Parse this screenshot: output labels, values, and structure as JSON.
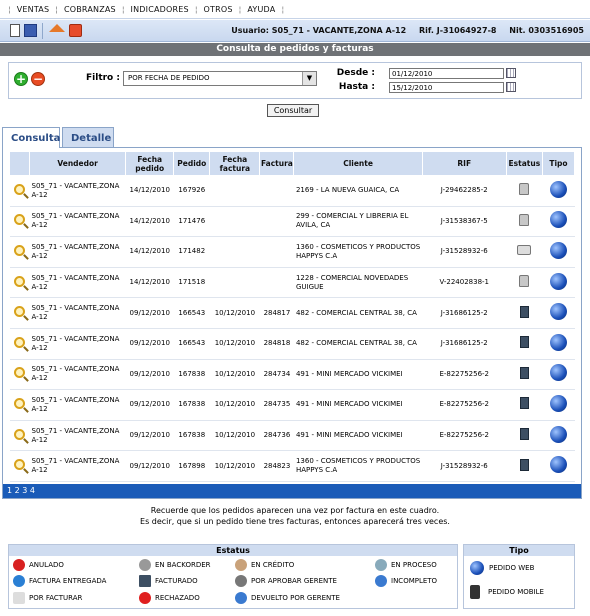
{
  "menu": [
    "VENTAS",
    "COBRANZAS",
    "INDICADORES",
    "OTROS",
    "AYUDA"
  ],
  "user": {
    "usuario": "Usuario: S05_71 - VACANTE,ZONA A-12",
    "rif": "Rif. J-31064927-8",
    "nit": "Nit. 0303516905"
  },
  "page_title": "Consulta de pedidos y facturas",
  "filter": {
    "label": "Filtro :",
    "value": "POR FECHA DE PEDIDO",
    "desde_label": "Desde :",
    "desde": "01/12/2010",
    "hasta_label": "Hasta :",
    "hasta": "15/12/2010",
    "button": "Consultar"
  },
  "tabs": [
    "Consulta",
    "Detalle"
  ],
  "table": {
    "headers": [
      "",
      "Vendedor",
      "Fecha pedido",
      "Pedido",
      "Fecha factura",
      "Factura",
      "Cliente",
      "RIF",
      "Estatus",
      "Tipo"
    ],
    "rows": [
      {
        "vendedor": "S05_71 - VACANTE,ZONA A-12",
        "fpedido": "14/12/2010",
        "pedido": "167926",
        "ffactura": "",
        "factura": "",
        "cliente": "2169 - LA NUEVA GUAICA, CA",
        "rif": "J-29462285-2",
        "estatus": "lock-icon"
      },
      {
        "vendedor": "S05_71 - VACANTE,ZONA A-12",
        "fpedido": "14/12/2010",
        "pedido": "171476",
        "ffactura": "",
        "factura": "",
        "cliente": "299 - COMERCIAL Y LIBRERIA EL AVILA, CA",
        "rif": "J-31538367-5",
        "estatus": "lock-icon"
      },
      {
        "vendedor": "S05_71 - VACANTE,ZONA A-12",
        "fpedido": "14/12/2010",
        "pedido": "171482",
        "ffactura": "",
        "factura": "",
        "cliente": "1360 - COSMETICOS Y PRODUCTOS HAPPYS C.A",
        "rif": "J-31528932-6",
        "estatus": "printer-icon"
      },
      {
        "vendedor": "S05_71 - VACANTE,ZONA A-12",
        "fpedido": "14/12/2010",
        "pedido": "171518",
        "ffactura": "",
        "factura": "",
        "cliente": "1228 - COMERCIAL NOVEDADES GUIGUE",
        "rif": "V-22402838-1",
        "estatus": "lock-icon"
      },
      {
        "vendedor": "S05_71 - VACANTE,ZONA A-12",
        "fpedido": "09/12/2010",
        "pedido": "166543",
        "ffactura": "10/12/2010",
        "factura": "284817",
        "cliente": "482 - COMERCIAL CENTRAL 38, CA",
        "rif": "J-31686125-2",
        "estatus": "book-icon"
      },
      {
        "vendedor": "S05_71 - VACANTE,ZONA A-12",
        "fpedido": "09/12/2010",
        "pedido": "166543",
        "ffactura": "10/12/2010",
        "factura": "284818",
        "cliente": "482 - COMERCIAL CENTRAL 38, CA",
        "rif": "J-31686125-2",
        "estatus": "book-icon"
      },
      {
        "vendedor": "S05_71 - VACANTE,ZONA A-12",
        "fpedido": "09/12/2010",
        "pedido": "167838",
        "ffactura": "10/12/2010",
        "factura": "284734",
        "cliente": "491 - MINI MERCADO VICKIMEI",
        "rif": "E-82275256-2",
        "estatus": "book-icon"
      },
      {
        "vendedor": "S05_71 - VACANTE,ZONA A-12",
        "fpedido": "09/12/2010",
        "pedido": "167838",
        "ffactura": "10/12/2010",
        "factura": "284735",
        "cliente": "491 - MINI MERCADO VICKIMEI",
        "rif": "E-82275256-2",
        "estatus": "book-icon"
      },
      {
        "vendedor": "S05_71 - VACANTE,ZONA A-12",
        "fpedido": "09/12/2010",
        "pedido": "167838",
        "ffactura": "10/12/2010",
        "factura": "284736",
        "cliente": "491 - MINI MERCADO VICKIMEI",
        "rif": "E-82275256-2",
        "estatus": "book-icon"
      },
      {
        "vendedor": "S05_71 - VACANTE,ZONA A-12",
        "fpedido": "09/12/2010",
        "pedido": "167898",
        "ffactura": "10/12/2010",
        "factura": "284823",
        "cliente": "1360 - COSMETICOS Y PRODUCTOS HAPPYS C.A",
        "rif": "J-31528932-6",
        "estatus": "book-icon"
      }
    ]
  },
  "pager": "1 2 3 4",
  "note": {
    "line1": "Recuerde que los pedidos aparecen una vez por factura en este cuadro.",
    "line2": "Es decir, que si un pedido tiene tres facturas, entonces aparecerá tres veces."
  },
  "legend": {
    "title": "Estatus",
    "items": [
      "ANULADO",
      "EN BACKORDER",
      "EN CRÉDITO",
      "EN PROCESO",
      "FACTURA ENTREGADA",
      "FACTURADO",
      "POR APROBAR GERENTE",
      "INCOMPLETO",
      "POR FACTURAR",
      "RECHAZADO",
      "DEVUELTO POR GERENTE"
    ]
  },
  "tipo": {
    "title": "Tipo",
    "items": [
      "PEDIDO WEB",
      "PEDIDO MOBILE"
    ]
  }
}
